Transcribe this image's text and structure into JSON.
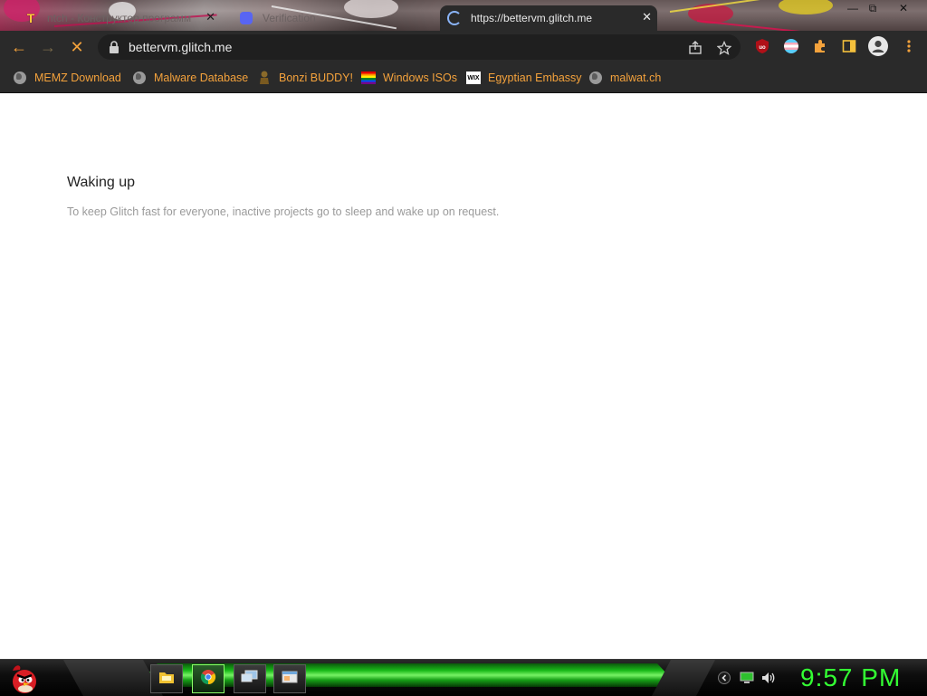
{
  "browser": {
    "tabs": [
      {
        "title": "ntch - Конструктор программ",
        "icon": "t-logo-icon",
        "active": false
      },
      {
        "title": "Verification",
        "icon": "discord-icon",
        "active": false
      },
      {
        "title": "https://bettervm.glitch.me",
        "icon": "loading-spinner-icon",
        "active": true
      }
    ],
    "window_controls": {
      "minimize": "—",
      "maximize": "⧉",
      "close": "✕"
    },
    "nav": {
      "back": "←",
      "forward": "→",
      "stop": "✕"
    },
    "url": "bettervm.glitch.me",
    "close_glyph": "✕",
    "bookmarks": [
      {
        "label": "MEMZ Download",
        "icon": "globe-icon"
      },
      {
        "label": "Malware Database",
        "icon": "globe-icon"
      },
      {
        "label": "Bonzi BUDDY!",
        "icon": "bonzi-icon"
      },
      {
        "label": "Windows ISOs",
        "icon": "rainbow-flag-icon"
      },
      {
        "label": "Egyptian Embassy",
        "icon": "wix-icon"
      },
      {
        "label": "malwat.ch",
        "icon": "globe-icon"
      }
    ],
    "extensions": {
      "ublock_label": "uo"
    }
  },
  "page": {
    "heading": "Waking up",
    "description": "To keep Glitch fast for everyone, inactive projects go to sleep and wake up on request."
  },
  "taskbar": {
    "clock": "9:57 PM",
    "tasks": [
      "file-explorer-icon",
      "chrome-icon",
      "remote-desktop-icon",
      "window-icon"
    ]
  },
  "colors": {
    "bookmark_text": "#f4a23c",
    "toolbar_bg": "#2a2a2a",
    "clock": "#33ff33",
    "taskbar_glow": "#19c219"
  }
}
